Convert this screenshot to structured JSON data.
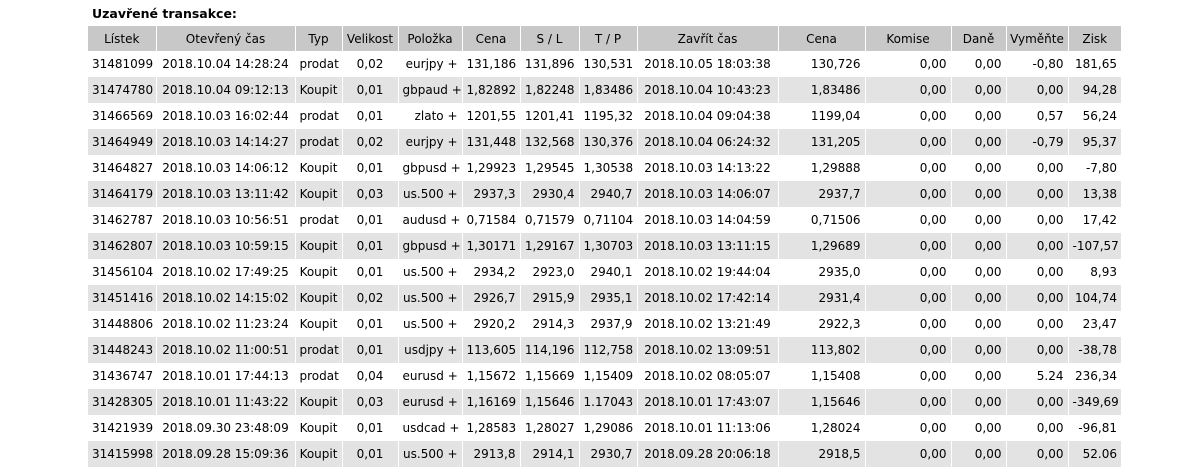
{
  "section_title": "Uzavřené transakce:",
  "columns": [
    "Lístek",
    "Otevřený čas",
    "Typ",
    "Velikost",
    "Položka",
    "Cena",
    "S / L",
    "T / P",
    "Zavřít čas",
    "Cena",
    "Komise",
    "Daně",
    "Vyměňte",
    "Zisk"
  ],
  "rows": [
    [
      "31481099",
      "2018.10.04 14:28:24",
      "prodat",
      "0,02",
      "eurjpy +",
      "131,186",
      "131,896",
      "130,531",
      "2018.10.05 18:03:38",
      "130,726",
      "0,00",
      "0,00",
      "-0,80",
      "181,65"
    ],
    [
      "31474780",
      "2018.10.04 09:12:13",
      "Koupit",
      "0,01",
      "gbpaud +",
      "1,82892",
      "1,82248",
      "1,83486",
      "2018.10.04 10:43:23",
      "1,83486",
      "0,00",
      "0,00",
      "0,00",
      "94,28"
    ],
    [
      "31466569",
      "2018.10.03 16:02:44",
      "prodat",
      "0,01",
      "zlato +",
      "1201,55",
      "1201,41",
      "1195,32",
      "2018.10.04 09:04:38",
      "1199,04",
      "0,00",
      "0,00",
      "0,57",
      "56,24"
    ],
    [
      "31464949",
      "2018.10.03 14:14:27",
      "prodat",
      "0,02",
      "eurjpy +",
      "131,448",
      "132,568",
      "130,376",
      "2018.10.04 06:24:32",
      "131,205",
      "0,00",
      "0,00",
      "-0,79",
      "95,37"
    ],
    [
      "31464827",
      "2018.10.03 14:06:12",
      "Koupit",
      "0,01",
      "gbpusd +",
      "1,29923",
      "1,29545",
      "1,30538",
      "2018.10.03 14:13:22",
      "1,29888",
      "0,00",
      "0,00",
      "0,00",
      "-7,80"
    ],
    [
      "31464179",
      "2018.10.03 13:11:42",
      "Koupit",
      "0,03",
      "us.500 +",
      "2937,3",
      "2930,4",
      "2940,7",
      "2018.10.03 14:06:07",
      "2937,7",
      "0,00",
      "0,00",
      "0,00",
      "13,38"
    ],
    [
      "31462787",
      "2018.10.03 10:56:51",
      "prodat",
      "0,01",
      "audusd +",
      "0,71584",
      "0,71579",
      "0,71104",
      "2018.10.03 14:04:59",
      "0,71506",
      "0,00",
      "0,00",
      "0,00",
      "17,42"
    ],
    [
      "31462807",
      "2018.10.03 10:59:15",
      "Koupit",
      "0,01",
      "gbpusd +",
      "1,30171",
      "1,29167",
      "1,30703",
      "2018.10.03 13:11:15",
      "1,29689",
      "0,00",
      "0,00",
      "0,00",
      "-107,57"
    ],
    [
      "31456104",
      "2018.10.02 17:49:25",
      "Koupit",
      "0,01",
      "us.500 +",
      "2934,2",
      "2923,0",
      "2940,1",
      "2018.10.02 19:44:04",
      "2935,0",
      "0,00",
      "0,00",
      "0,00",
      "8,93"
    ],
    [
      "31451416",
      "2018.10.02 14:15:02",
      "Koupit",
      "0,02",
      "us.500 +",
      "2926,7",
      "2915,9",
      "2935,1",
      "2018.10.02 17:42:14",
      "2931,4",
      "0,00",
      "0,00",
      "0,00",
      "104,74"
    ],
    [
      "31448806",
      "2018.10.02 11:23:24",
      "Koupit",
      "0,01",
      "us.500 +",
      "2920,2",
      "2914,3",
      "2937,9",
      "2018.10.02 13:21:49",
      "2922,3",
      "0,00",
      "0,00",
      "0,00",
      "23,47"
    ],
    [
      "31448243",
      "2018.10.02 11:00:51",
      "prodat",
      "0,01",
      "usdjpy +",
      "113,605",
      "114,196",
      "112,758",
      "2018.10.02 13:09:51",
      "113,802",
      "0,00",
      "0,00",
      "0,00",
      "-38,78"
    ],
    [
      "31436747",
      "2018.10.01 17:44:13",
      "prodat",
      "0,04",
      "eurusd +",
      "1,15672",
      "1,15669",
      "1,15409",
      "2018.10.02 08:05:07",
      "1,15408",
      "0,00",
      "0,00",
      "5.24",
      "236,34"
    ],
    [
      "31428305",
      "2018.10.01 11:43:22",
      "Koupit",
      "0,03",
      "eurusd +",
      "1,16169",
      "1,15646",
      "1.17043",
      "2018.10.01 17:43:07",
      "1,15646",
      "0,00",
      "0,00",
      "0,00",
      "-349,69"
    ],
    [
      "31421939",
      "2018.09.30 23:48:09",
      "Koupit",
      "0,01",
      "usdcad +",
      "1,28583",
      "1,28027",
      "1,29086",
      "2018.10.01 11:13:06",
      "1,28024",
      "0,00",
      "0,00",
      "0,00",
      "-96,81"
    ],
    [
      "31415998",
      "2018.09.28 15:09:36",
      "Koupit",
      "0,01",
      "us.500 +",
      "2913,8",
      "2914,1",
      "2930,7",
      "2018.09.28 20:06:18",
      "2918,5",
      "0,00",
      "0,00",
      "0,00",
      "52.06"
    ]
  ]
}
